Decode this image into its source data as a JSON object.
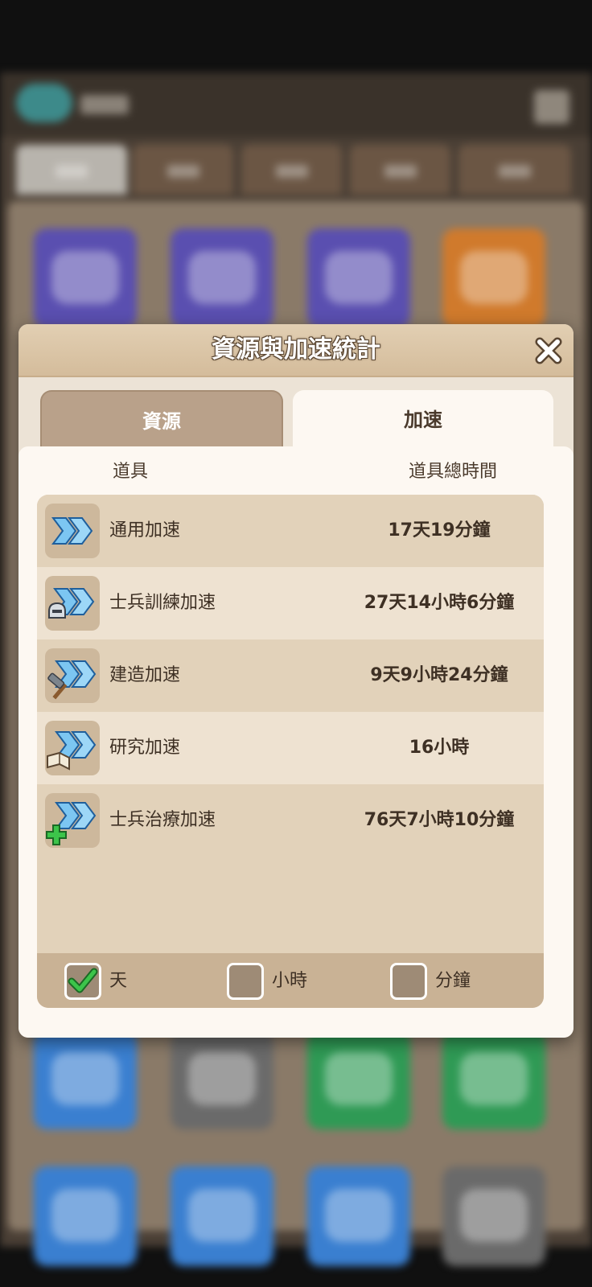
{
  "dialog": {
    "title": "資源與加速統計",
    "tabs": [
      {
        "label": "資源",
        "active": false
      },
      {
        "label": "加速",
        "active": true
      }
    ],
    "columns": {
      "item": "道具",
      "total_time": "道具總時間"
    },
    "rows": [
      {
        "name": "通用加速",
        "time": "17天19分鐘",
        "icon": "speedup-chevrons-icon"
      },
      {
        "name": "士兵訓練加速",
        "time": "27天14小時6分鐘",
        "icon": "training-speedup-icon"
      },
      {
        "name": "建造加速",
        "time": "9天9小時24分鐘",
        "icon": "building-speedup-icon"
      },
      {
        "name": "研究加速",
        "time": "16小時",
        "icon": "research-speedup-icon"
      },
      {
        "name": "士兵治療加速",
        "time": "76天7小時10分鐘",
        "icon": "healing-speedup-icon"
      }
    ],
    "units": [
      {
        "label": "天",
        "checked": true
      },
      {
        "label": "小時",
        "checked": false
      },
      {
        "label": "分鐘",
        "checked": false
      }
    ]
  },
  "colors": {
    "header": "#d4bc9b",
    "panel": "#fdf8f2",
    "list": "#e2d2ba",
    "accent_check": "#3cc44a",
    "icon_blue": "#5fb6e8"
  }
}
